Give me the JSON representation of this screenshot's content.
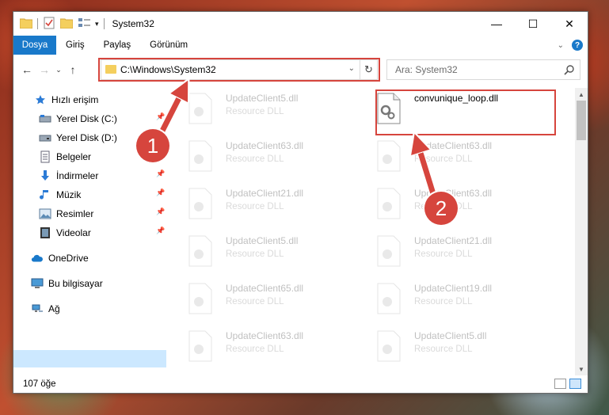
{
  "window": {
    "title": "System32",
    "controls": {
      "minimize": "—",
      "maximize": "☐",
      "close": "✕"
    }
  },
  "ribbon": {
    "tabs": [
      "Dosya",
      "Giriş",
      "Paylaş",
      "Görünüm"
    ],
    "expand_icon": "chevron-down-icon",
    "help": "?"
  },
  "navigation": {
    "back": "←",
    "forward": "→",
    "recent": "⌄",
    "up": "↑"
  },
  "address": {
    "path": "C:\\Windows\\System32",
    "dropdown": "⌄",
    "refresh": "↻"
  },
  "search": {
    "placeholder": "Ara: System32"
  },
  "sidebar": {
    "quick_access": "Hızlı erişim",
    "items": [
      {
        "label": "Yerel Disk (C:)",
        "icon": "drive-icon",
        "pinned": true
      },
      {
        "label": "Yerel Disk (D:)",
        "icon": "drive-icon",
        "pinned": false
      },
      {
        "label": "Belgeler",
        "icon": "documents-icon",
        "pinned": true
      },
      {
        "label": "İndirmeler",
        "icon": "downloads-icon",
        "pinned": true
      },
      {
        "label": "Müzik",
        "icon": "music-icon",
        "pinned": true
      },
      {
        "label": "Resimler",
        "icon": "pictures-icon",
        "pinned": true
      },
      {
        "label": "Videolar",
        "icon": "videos-icon",
        "pinned": true
      }
    ],
    "onedrive": "OneDrive",
    "this_pc": "Bu bilgisayar",
    "network": "Ağ"
  },
  "files": {
    "left_column": [
      {
        "name": "UpdateClient5.dll",
        "type": "Resource DLL"
      },
      {
        "name": "UpdateClient63.dll",
        "type": "Resource DLL"
      },
      {
        "name": "UpdateClient21.dll",
        "type": "Resource DLL"
      },
      {
        "name": "UpdateClient5.dll",
        "type": "Resource DLL"
      },
      {
        "name": "UpdateClient65.dll",
        "type": "Resource DLL"
      },
      {
        "name": "UpdateClient63.dll",
        "type": "Resource DLL"
      }
    ],
    "right_column": [
      {
        "name": "convunique_loop.dll",
        "type": ""
      },
      {
        "name": "UpdateClient63.dll",
        "type": "Resource DLL"
      },
      {
        "name": "UpdateClient63.dll",
        "type": "Resource DLL"
      },
      {
        "name": "UpdateClient21.dll",
        "type": "Resource DLL"
      },
      {
        "name": "UpdateClient19.dll",
        "type": "Resource DLL"
      },
      {
        "name": "UpdateClient5.dll",
        "type": "Resource DLL"
      }
    ]
  },
  "status": {
    "item_count": "107 öğe"
  },
  "annotations": {
    "step1": "1",
    "step2": "2",
    "color": "#d6453d"
  }
}
